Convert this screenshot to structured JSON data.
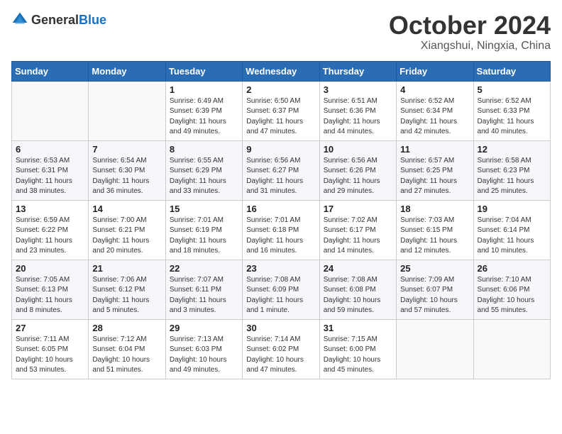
{
  "logo": {
    "general": "General",
    "blue": "Blue"
  },
  "header": {
    "month": "October 2024",
    "location": "Xiangshui, Ningxia, China"
  },
  "weekdays": [
    "Sunday",
    "Monday",
    "Tuesday",
    "Wednesday",
    "Thursday",
    "Friday",
    "Saturday"
  ],
  "weeks": [
    [
      {
        "day": "",
        "sunrise": "",
        "sunset": "",
        "daylight": ""
      },
      {
        "day": "",
        "sunrise": "",
        "sunset": "",
        "daylight": ""
      },
      {
        "day": "1",
        "sunrise": "Sunrise: 6:49 AM",
        "sunset": "Sunset: 6:39 PM",
        "daylight": "Daylight: 11 hours and 49 minutes."
      },
      {
        "day": "2",
        "sunrise": "Sunrise: 6:50 AM",
        "sunset": "Sunset: 6:37 PM",
        "daylight": "Daylight: 11 hours and 47 minutes."
      },
      {
        "day": "3",
        "sunrise": "Sunrise: 6:51 AM",
        "sunset": "Sunset: 6:36 PM",
        "daylight": "Daylight: 11 hours and 44 minutes."
      },
      {
        "day": "4",
        "sunrise": "Sunrise: 6:52 AM",
        "sunset": "Sunset: 6:34 PM",
        "daylight": "Daylight: 11 hours and 42 minutes."
      },
      {
        "day": "5",
        "sunrise": "Sunrise: 6:52 AM",
        "sunset": "Sunset: 6:33 PM",
        "daylight": "Daylight: 11 hours and 40 minutes."
      }
    ],
    [
      {
        "day": "6",
        "sunrise": "Sunrise: 6:53 AM",
        "sunset": "Sunset: 6:31 PM",
        "daylight": "Daylight: 11 hours and 38 minutes."
      },
      {
        "day": "7",
        "sunrise": "Sunrise: 6:54 AM",
        "sunset": "Sunset: 6:30 PM",
        "daylight": "Daylight: 11 hours and 36 minutes."
      },
      {
        "day": "8",
        "sunrise": "Sunrise: 6:55 AM",
        "sunset": "Sunset: 6:29 PM",
        "daylight": "Daylight: 11 hours and 33 minutes."
      },
      {
        "day": "9",
        "sunrise": "Sunrise: 6:56 AM",
        "sunset": "Sunset: 6:27 PM",
        "daylight": "Daylight: 11 hours and 31 minutes."
      },
      {
        "day": "10",
        "sunrise": "Sunrise: 6:56 AM",
        "sunset": "Sunset: 6:26 PM",
        "daylight": "Daylight: 11 hours and 29 minutes."
      },
      {
        "day": "11",
        "sunrise": "Sunrise: 6:57 AM",
        "sunset": "Sunset: 6:25 PM",
        "daylight": "Daylight: 11 hours and 27 minutes."
      },
      {
        "day": "12",
        "sunrise": "Sunrise: 6:58 AM",
        "sunset": "Sunset: 6:23 PM",
        "daylight": "Daylight: 11 hours and 25 minutes."
      }
    ],
    [
      {
        "day": "13",
        "sunrise": "Sunrise: 6:59 AM",
        "sunset": "Sunset: 6:22 PM",
        "daylight": "Daylight: 11 hours and 23 minutes."
      },
      {
        "day": "14",
        "sunrise": "Sunrise: 7:00 AM",
        "sunset": "Sunset: 6:21 PM",
        "daylight": "Daylight: 11 hours and 20 minutes."
      },
      {
        "day": "15",
        "sunrise": "Sunrise: 7:01 AM",
        "sunset": "Sunset: 6:19 PM",
        "daylight": "Daylight: 11 hours and 18 minutes."
      },
      {
        "day": "16",
        "sunrise": "Sunrise: 7:01 AM",
        "sunset": "Sunset: 6:18 PM",
        "daylight": "Daylight: 11 hours and 16 minutes."
      },
      {
        "day": "17",
        "sunrise": "Sunrise: 7:02 AM",
        "sunset": "Sunset: 6:17 PM",
        "daylight": "Daylight: 11 hours and 14 minutes."
      },
      {
        "day": "18",
        "sunrise": "Sunrise: 7:03 AM",
        "sunset": "Sunset: 6:15 PM",
        "daylight": "Daylight: 11 hours and 12 minutes."
      },
      {
        "day": "19",
        "sunrise": "Sunrise: 7:04 AM",
        "sunset": "Sunset: 6:14 PM",
        "daylight": "Daylight: 11 hours and 10 minutes."
      }
    ],
    [
      {
        "day": "20",
        "sunrise": "Sunrise: 7:05 AM",
        "sunset": "Sunset: 6:13 PM",
        "daylight": "Daylight: 11 hours and 8 minutes."
      },
      {
        "day": "21",
        "sunrise": "Sunrise: 7:06 AM",
        "sunset": "Sunset: 6:12 PM",
        "daylight": "Daylight: 11 hours and 5 minutes."
      },
      {
        "day": "22",
        "sunrise": "Sunrise: 7:07 AM",
        "sunset": "Sunset: 6:11 PM",
        "daylight": "Daylight: 11 hours and 3 minutes."
      },
      {
        "day": "23",
        "sunrise": "Sunrise: 7:08 AM",
        "sunset": "Sunset: 6:09 PM",
        "daylight": "Daylight: 11 hours and 1 minute."
      },
      {
        "day": "24",
        "sunrise": "Sunrise: 7:08 AM",
        "sunset": "Sunset: 6:08 PM",
        "daylight": "Daylight: 10 hours and 59 minutes."
      },
      {
        "day": "25",
        "sunrise": "Sunrise: 7:09 AM",
        "sunset": "Sunset: 6:07 PM",
        "daylight": "Daylight: 10 hours and 57 minutes."
      },
      {
        "day": "26",
        "sunrise": "Sunrise: 7:10 AM",
        "sunset": "Sunset: 6:06 PM",
        "daylight": "Daylight: 10 hours and 55 minutes."
      }
    ],
    [
      {
        "day": "27",
        "sunrise": "Sunrise: 7:11 AM",
        "sunset": "Sunset: 6:05 PM",
        "daylight": "Daylight: 10 hours and 53 minutes."
      },
      {
        "day": "28",
        "sunrise": "Sunrise: 7:12 AM",
        "sunset": "Sunset: 6:04 PM",
        "daylight": "Daylight: 10 hours and 51 minutes."
      },
      {
        "day": "29",
        "sunrise": "Sunrise: 7:13 AM",
        "sunset": "Sunset: 6:03 PM",
        "daylight": "Daylight: 10 hours and 49 minutes."
      },
      {
        "day": "30",
        "sunrise": "Sunrise: 7:14 AM",
        "sunset": "Sunset: 6:02 PM",
        "daylight": "Daylight: 10 hours and 47 minutes."
      },
      {
        "day": "31",
        "sunrise": "Sunrise: 7:15 AM",
        "sunset": "Sunset: 6:00 PM",
        "daylight": "Daylight: 10 hours and 45 minutes."
      },
      {
        "day": "",
        "sunrise": "",
        "sunset": "",
        "daylight": ""
      },
      {
        "day": "",
        "sunrise": "",
        "sunset": "",
        "daylight": ""
      }
    ]
  ]
}
